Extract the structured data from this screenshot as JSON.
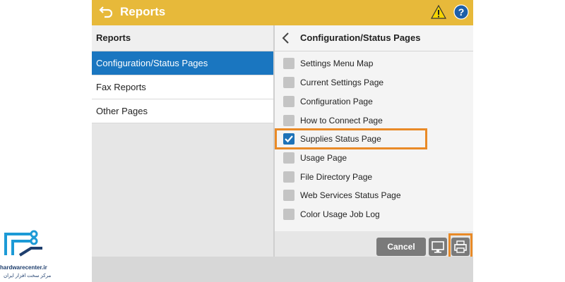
{
  "header": {
    "title": "Reports"
  },
  "left_panel": {
    "heading": "Reports",
    "items": [
      {
        "label": "Configuration/Status Pages",
        "active": true
      },
      {
        "label": "Fax Reports",
        "active": false
      },
      {
        "label": "Other Pages",
        "active": false
      }
    ]
  },
  "right_panel": {
    "heading": "Configuration/Status Pages",
    "options": [
      {
        "label": "Settings Menu Map",
        "checked": false
      },
      {
        "label": "Current Settings Page",
        "checked": false
      },
      {
        "label": "Configuration Page",
        "checked": false
      },
      {
        "label": "How to Connect Page",
        "checked": false
      },
      {
        "label": "Supplies Status Page",
        "checked": true
      },
      {
        "label": "Usage Page",
        "checked": false
      },
      {
        "label": "File Directory Page",
        "checked": false
      },
      {
        "label": "Web Services Status Page",
        "checked": false
      },
      {
        "label": "Color Usage Job Log",
        "checked": false
      }
    ]
  },
  "footer": {
    "cancel_label": "Cancel"
  },
  "watermark": {
    "site": "hardwarecenter.ir",
    "tagline": "مرکز سخت افزار ایران"
  },
  "colors": {
    "topbar": "#e7b93a",
    "selected": "#1a76c0",
    "highlight": "#e98a27"
  }
}
